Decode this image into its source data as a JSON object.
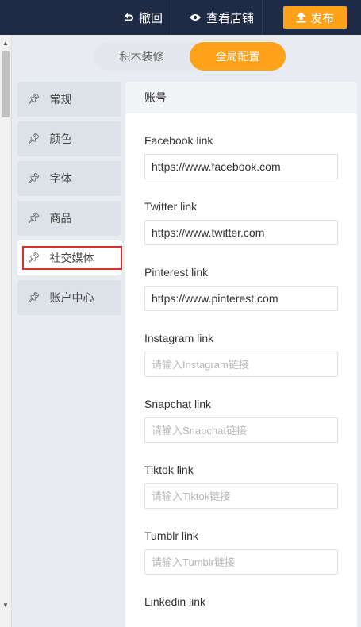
{
  "topbar": {
    "undo_label": "撤回",
    "view_store_label": "查看店铺",
    "publish_label": "发布"
  },
  "segment": {
    "tabs": [
      {
        "label": "积木装修",
        "active": false
      },
      {
        "label": "全局配置",
        "active": true
      }
    ]
  },
  "menu": {
    "items": [
      {
        "label": "常规",
        "icon": "pin-icon"
      },
      {
        "label": "颜色",
        "icon": "pin-icon"
      },
      {
        "label": "字体",
        "icon": "pin-icon"
      },
      {
        "label": "商品",
        "icon": "pin-icon"
      },
      {
        "label": "社交媒体",
        "icon": "pin-icon",
        "active": true
      },
      {
        "label": "账户中心",
        "icon": "pin-icon"
      }
    ]
  },
  "panel": {
    "title": "账号",
    "fields": [
      {
        "label": "Facebook link",
        "value": "https://www.facebook.com",
        "placeholder": ""
      },
      {
        "label": "Twitter link",
        "value": "https://www.twitter.com",
        "placeholder": ""
      },
      {
        "label": "Pinterest link",
        "value": "https://www.pinterest.com",
        "placeholder": ""
      },
      {
        "label": "Instagram link",
        "value": "",
        "placeholder": "请输入Instagram链接"
      },
      {
        "label": "Snapchat link",
        "value": "",
        "placeholder": "请输入Snapchat链接"
      },
      {
        "label": "Tiktok link",
        "value": "",
        "placeholder": "请输入Tiktok链接"
      },
      {
        "label": "Tumblr link",
        "value": "",
        "placeholder": "请输入Tumblr链接"
      },
      {
        "label": "Linkedin link",
        "value": "",
        "placeholder": ""
      }
    ]
  },
  "colors": {
    "topbar_bg": "#1f2a44",
    "accent": "#ffa21a",
    "highlight_border": "#d9322b"
  }
}
